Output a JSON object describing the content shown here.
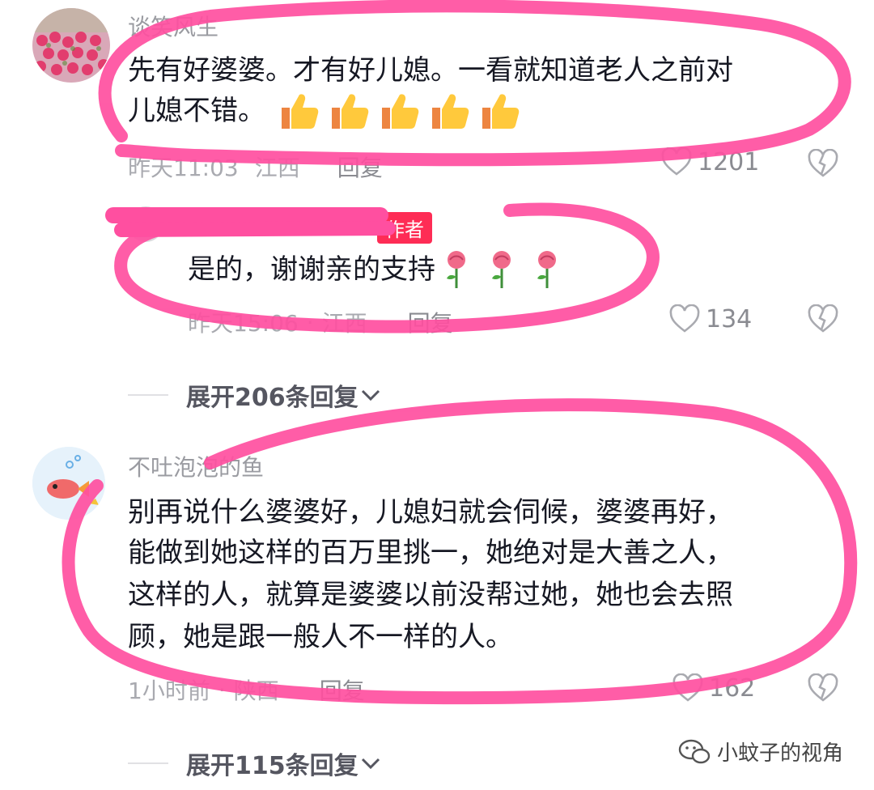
{
  "comments": [
    {
      "username": "谈笑风生",
      "text_line1": "先有好婆婆。才有好儿媳。一看就知道老人之前对",
      "text_line2": "儿媳不错。",
      "emoji": [
        "thumbs-up-icon",
        "thumbs-up-icon",
        "thumbs-up-icon",
        "thumbs-up-icon",
        "thumbs-up-icon"
      ],
      "time": "昨天11:03",
      "location": "江西",
      "reply_label": "回复",
      "likes": "1201"
    },
    {
      "reply": {
        "badge": "作者",
        "text": "是的，谢谢亲的支持",
        "emoji": [
          "rose-icon",
          "rose-icon",
          "rose-icon"
        ],
        "time": "昨天15:06",
        "location": "江西",
        "reply_label": "回复",
        "likes": "134"
      },
      "expand_label": "展开206条回复"
    },
    {
      "username": "不吐泡泡的鱼",
      "text_line1": "别再说什么婆婆好，儿媳妇就会伺候，婆婆再好，",
      "text_line2": "能做到她这样的百万里挑一，她绝对是大善之人，",
      "text_line3": "这样的人，就算是婆婆以前没帮过她，她也会去照",
      "text_line4": "顾，她是跟一般人不一样的人。",
      "time": "1小时前",
      "location": "陕西",
      "reply_label": "回复",
      "likes": "162",
      "expand_label": "展开115条回复"
    }
  ],
  "watermark": "小蚊子的视角",
  "colors": {
    "highlight": "#ff4fa0",
    "accent": "#fe2c55"
  }
}
